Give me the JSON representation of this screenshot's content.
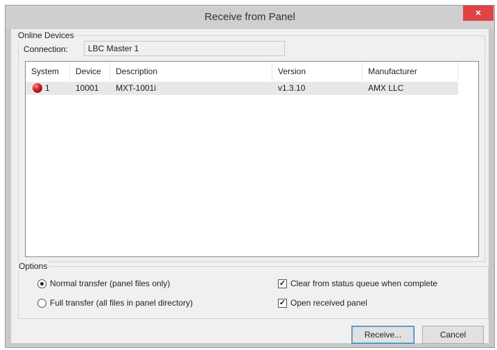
{
  "window": {
    "title": "Receive from Panel",
    "close_glyph": "×",
    "close_color": "#e04343"
  },
  "online_devices": {
    "group_label": "Online Devices",
    "connection_label": "Connection:",
    "connection_value": "LBC Master 1",
    "columns": [
      "System",
      "Device",
      "Description",
      "Version",
      "Manufacturer"
    ],
    "rows": [
      {
        "status_icon": "red-status-icon",
        "system": "1",
        "device": "10001",
        "description": "MXT-1001i",
        "version": "v1.3.10",
        "manufacturer": "AMX LLC"
      }
    ]
  },
  "options": {
    "group_label": "Options",
    "normal_transfer": {
      "label": "Normal transfer (panel files only)",
      "checked": true
    },
    "full_transfer": {
      "label": "Full transfer (all files in panel directory)",
      "checked": false
    },
    "clear_from_queue": {
      "label": "Clear from status queue when complete",
      "checked": true
    },
    "open_received": {
      "label": "Open received panel",
      "checked": true
    }
  },
  "buttons": {
    "receive": "Receive...",
    "cancel": "Cancel"
  }
}
